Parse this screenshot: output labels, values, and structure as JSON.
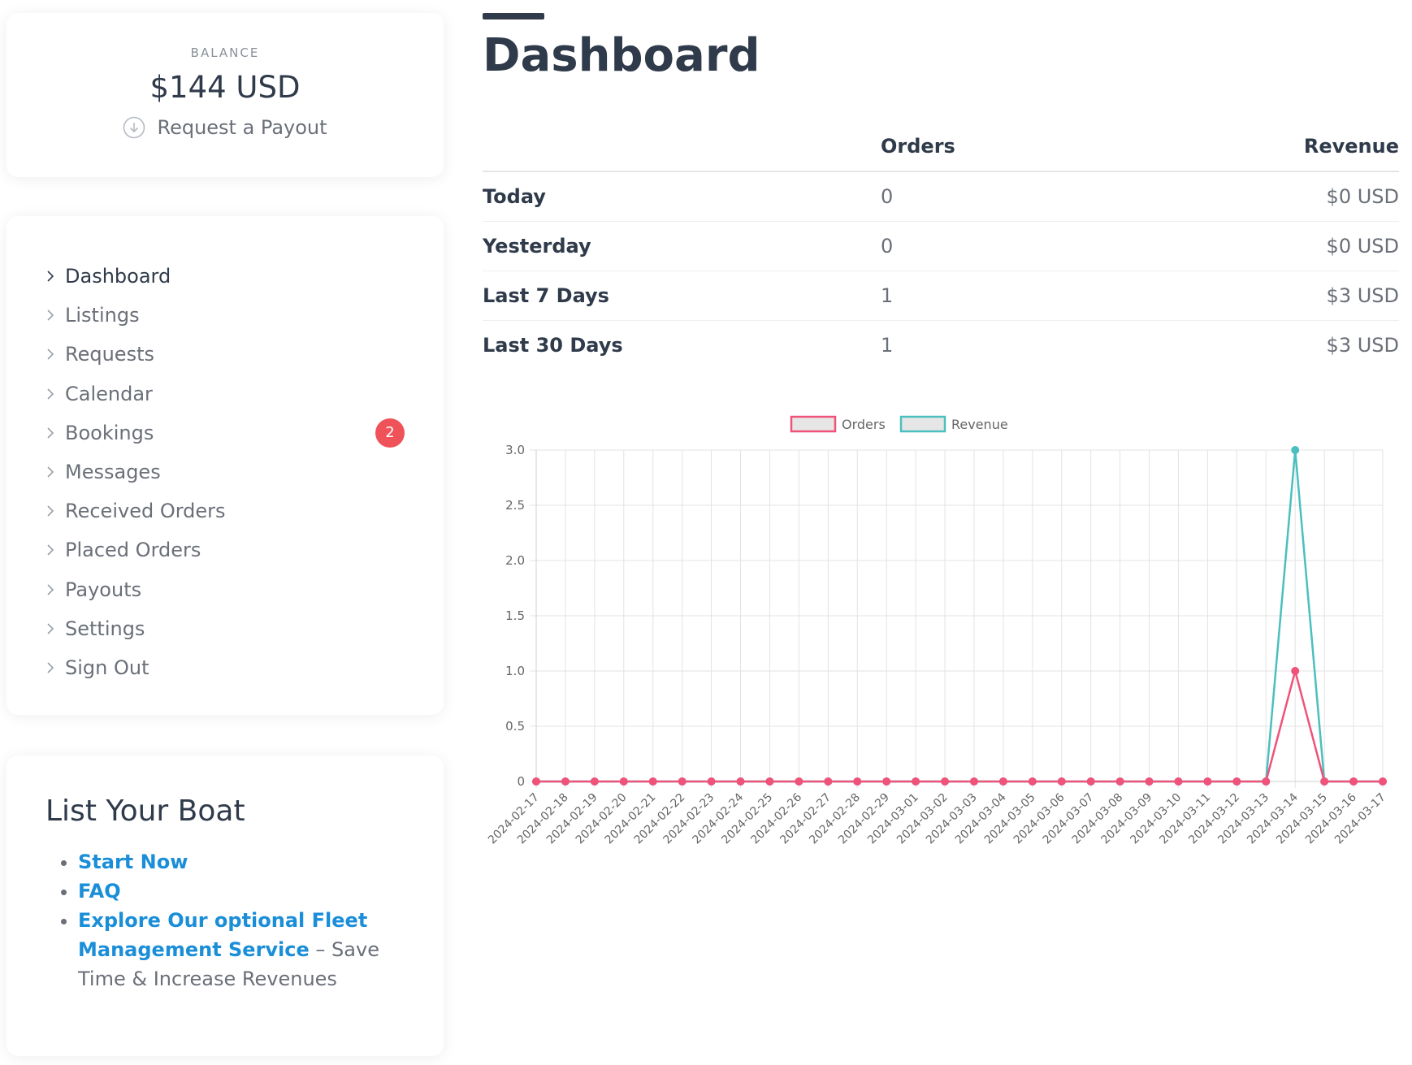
{
  "balance": {
    "label": "BALANCE",
    "amount": "$144 USD",
    "payout_label": "Request a Payout"
  },
  "nav": {
    "items": [
      {
        "label": "Dashboard",
        "active": true
      },
      {
        "label": "Listings"
      },
      {
        "label": "Requests"
      },
      {
        "label": "Calendar"
      },
      {
        "label": "Bookings",
        "badge": "2"
      },
      {
        "label": "Messages"
      },
      {
        "label": "Received Orders"
      },
      {
        "label": "Placed Orders"
      },
      {
        "label": "Payouts"
      },
      {
        "label": "Settings"
      },
      {
        "label": "Sign Out"
      }
    ]
  },
  "boat": {
    "title": "List Your Boat",
    "start_now": "Start Now",
    "faq": "FAQ",
    "fleet_link": "Explore Our optional Fleet Management Service",
    "fleet_suffix": " – Save Time & Increase Revenues"
  },
  "page": {
    "title": "Dashboard"
  },
  "stats": {
    "headers": {
      "orders": "Orders",
      "revenue": "Revenue"
    },
    "rows": [
      {
        "label": "Today",
        "orders": "0",
        "revenue": "$0 USD"
      },
      {
        "label": "Yesterday",
        "orders": "0",
        "revenue": "$0 USD"
      },
      {
        "label": "Last 7 Days",
        "orders": "1",
        "revenue": "$3 USD"
      },
      {
        "label": "Last 30 Days",
        "orders": "1",
        "revenue": "$3 USD"
      }
    ]
  },
  "colors": {
    "orders": "#f0527a",
    "revenue": "#4bbfbf",
    "badge": "#f0525a",
    "link": "#1a8ed8"
  },
  "icons": {
    "payout": "download-circle-icon",
    "nav": "chevron-right-icon"
  },
  "chart_data": {
    "type": "line",
    "title": "",
    "xlabel": "",
    "ylabel": "",
    "ylim": [
      0,
      3
    ],
    "yticks": [
      "0",
      "0.5",
      "1.0",
      "1.5",
      "2.0",
      "2.5",
      "3.0"
    ],
    "grid": true,
    "legend_position": "top",
    "x": [
      "2024-02-17",
      "2024-02-18",
      "2024-02-19",
      "2024-02-20",
      "2024-02-21",
      "2024-02-22",
      "2024-02-23",
      "2024-02-24",
      "2024-02-25",
      "2024-02-26",
      "2024-02-27",
      "2024-02-28",
      "2024-02-29",
      "2024-03-01",
      "2024-03-02",
      "2024-03-03",
      "2024-03-04",
      "2024-03-05",
      "2024-03-06",
      "2024-03-07",
      "2024-03-08",
      "2024-03-09",
      "2024-03-10",
      "2024-03-11",
      "2024-03-12",
      "2024-03-13",
      "2024-03-14",
      "2024-03-15",
      "2024-03-16",
      "2024-03-17"
    ],
    "series": [
      {
        "name": "Orders",
        "color": "#f0527a",
        "values": [
          0,
          0,
          0,
          0,
          0,
          0,
          0,
          0,
          0,
          0,
          0,
          0,
          0,
          0,
          0,
          0,
          0,
          0,
          0,
          0,
          0,
          0,
          0,
          0,
          0,
          0,
          1,
          0,
          0,
          0
        ]
      },
      {
        "name": "Revenue",
        "color": "#4bbfbf",
        "values": [
          0,
          0,
          0,
          0,
          0,
          0,
          0,
          0,
          0,
          0,
          0,
          0,
          0,
          0,
          0,
          0,
          0,
          0,
          0,
          0,
          0,
          0,
          0,
          0,
          0,
          0,
          3,
          0,
          0,
          0
        ]
      }
    ]
  }
}
